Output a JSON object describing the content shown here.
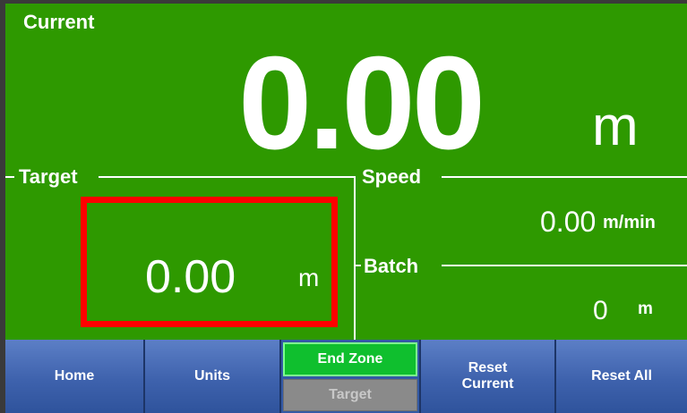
{
  "current": {
    "label": "Current",
    "value": "0.00",
    "unit": "m"
  },
  "target": {
    "label": "Target",
    "value": "0.00",
    "unit": "m"
  },
  "speed": {
    "label": "Speed",
    "value": "0.00",
    "unit": "m/min"
  },
  "batch": {
    "label": "Batch",
    "value": "0",
    "unit": "m"
  },
  "nav": {
    "home": "Home",
    "units": "Units",
    "end_zone": "End Zone",
    "target": "Target",
    "reset_current_line1": "Reset",
    "reset_current_line2": "Current",
    "reset_all": "Reset All"
  },
  "colors": {
    "screen_bg": "#2e9900",
    "target_border": "#ff0000",
    "end_zone_active": "#0fbf2e",
    "nav_bg": "#3e62ad"
  }
}
